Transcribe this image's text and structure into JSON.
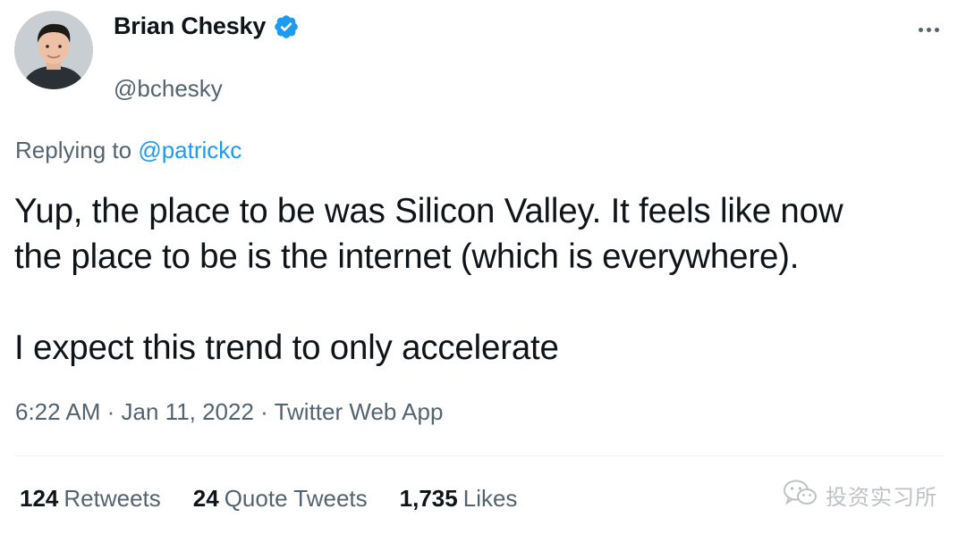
{
  "author": {
    "display_name": "Brian Chesky",
    "handle": "@bchesky",
    "verified": true,
    "avatar_icon": "profile-photo"
  },
  "reply": {
    "prefix": "Replying to ",
    "mention": "@patrickc"
  },
  "tweet": {
    "line1": "Yup, the place to be was Silicon Valley. It feels like now",
    "line2": "the place to be is the internet (which is everywhere).",
    "line3": "I expect this trend to only accelerate"
  },
  "meta": {
    "time": "6:22 AM",
    "separator": " · ",
    "date": "Jan 11, 2022",
    "source": "Twitter Web App"
  },
  "stats": {
    "retweets_count": "124",
    "retweets_label": "Retweets",
    "quotes_count": "24",
    "quotes_label": "Quote Tweets",
    "likes_count": "1,735",
    "likes_label": "Likes"
  },
  "watermark": {
    "text": "投资实习所",
    "icon": "wechat-icon"
  },
  "colors": {
    "accent": "#1d9bf0",
    "text": "#0f1419",
    "secondary": "#536471"
  }
}
